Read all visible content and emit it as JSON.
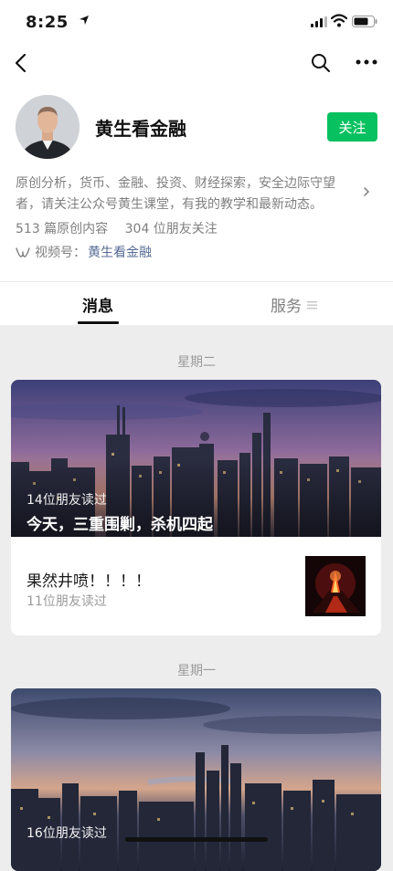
{
  "status_bar": {
    "time": "8:25"
  },
  "profile": {
    "name": "黄生看金融",
    "follow_label": "关注",
    "bio": "原创分析，货币、金融、投资、财经探索，安全边际守望者，请关注公众号黄生课堂，有我的教学和最新动态。",
    "original_count": "513 篇原创内容",
    "friends_following": "304 位朋友关注",
    "channel_label": "视频号：",
    "channel_name": "黄生看金融"
  },
  "tabs": [
    {
      "label": "消息",
      "active": true
    },
    {
      "label": "服务",
      "active": false
    }
  ],
  "feed": [
    {
      "day": "星期二",
      "cover_article": {
        "reads": "14位朋友读过",
        "title": "今天，三重围剿，杀机四起"
      },
      "sub_article": {
        "title": "果然井喷！！！！",
        "reads": "11位朋友读过"
      }
    },
    {
      "day": "星期一",
      "cover_article": {
        "reads": "16位朋友读过"
      }
    }
  ],
  "colors": {
    "accent_green": "#07c160",
    "link_blue": "#576b95",
    "background": "#ededed"
  }
}
